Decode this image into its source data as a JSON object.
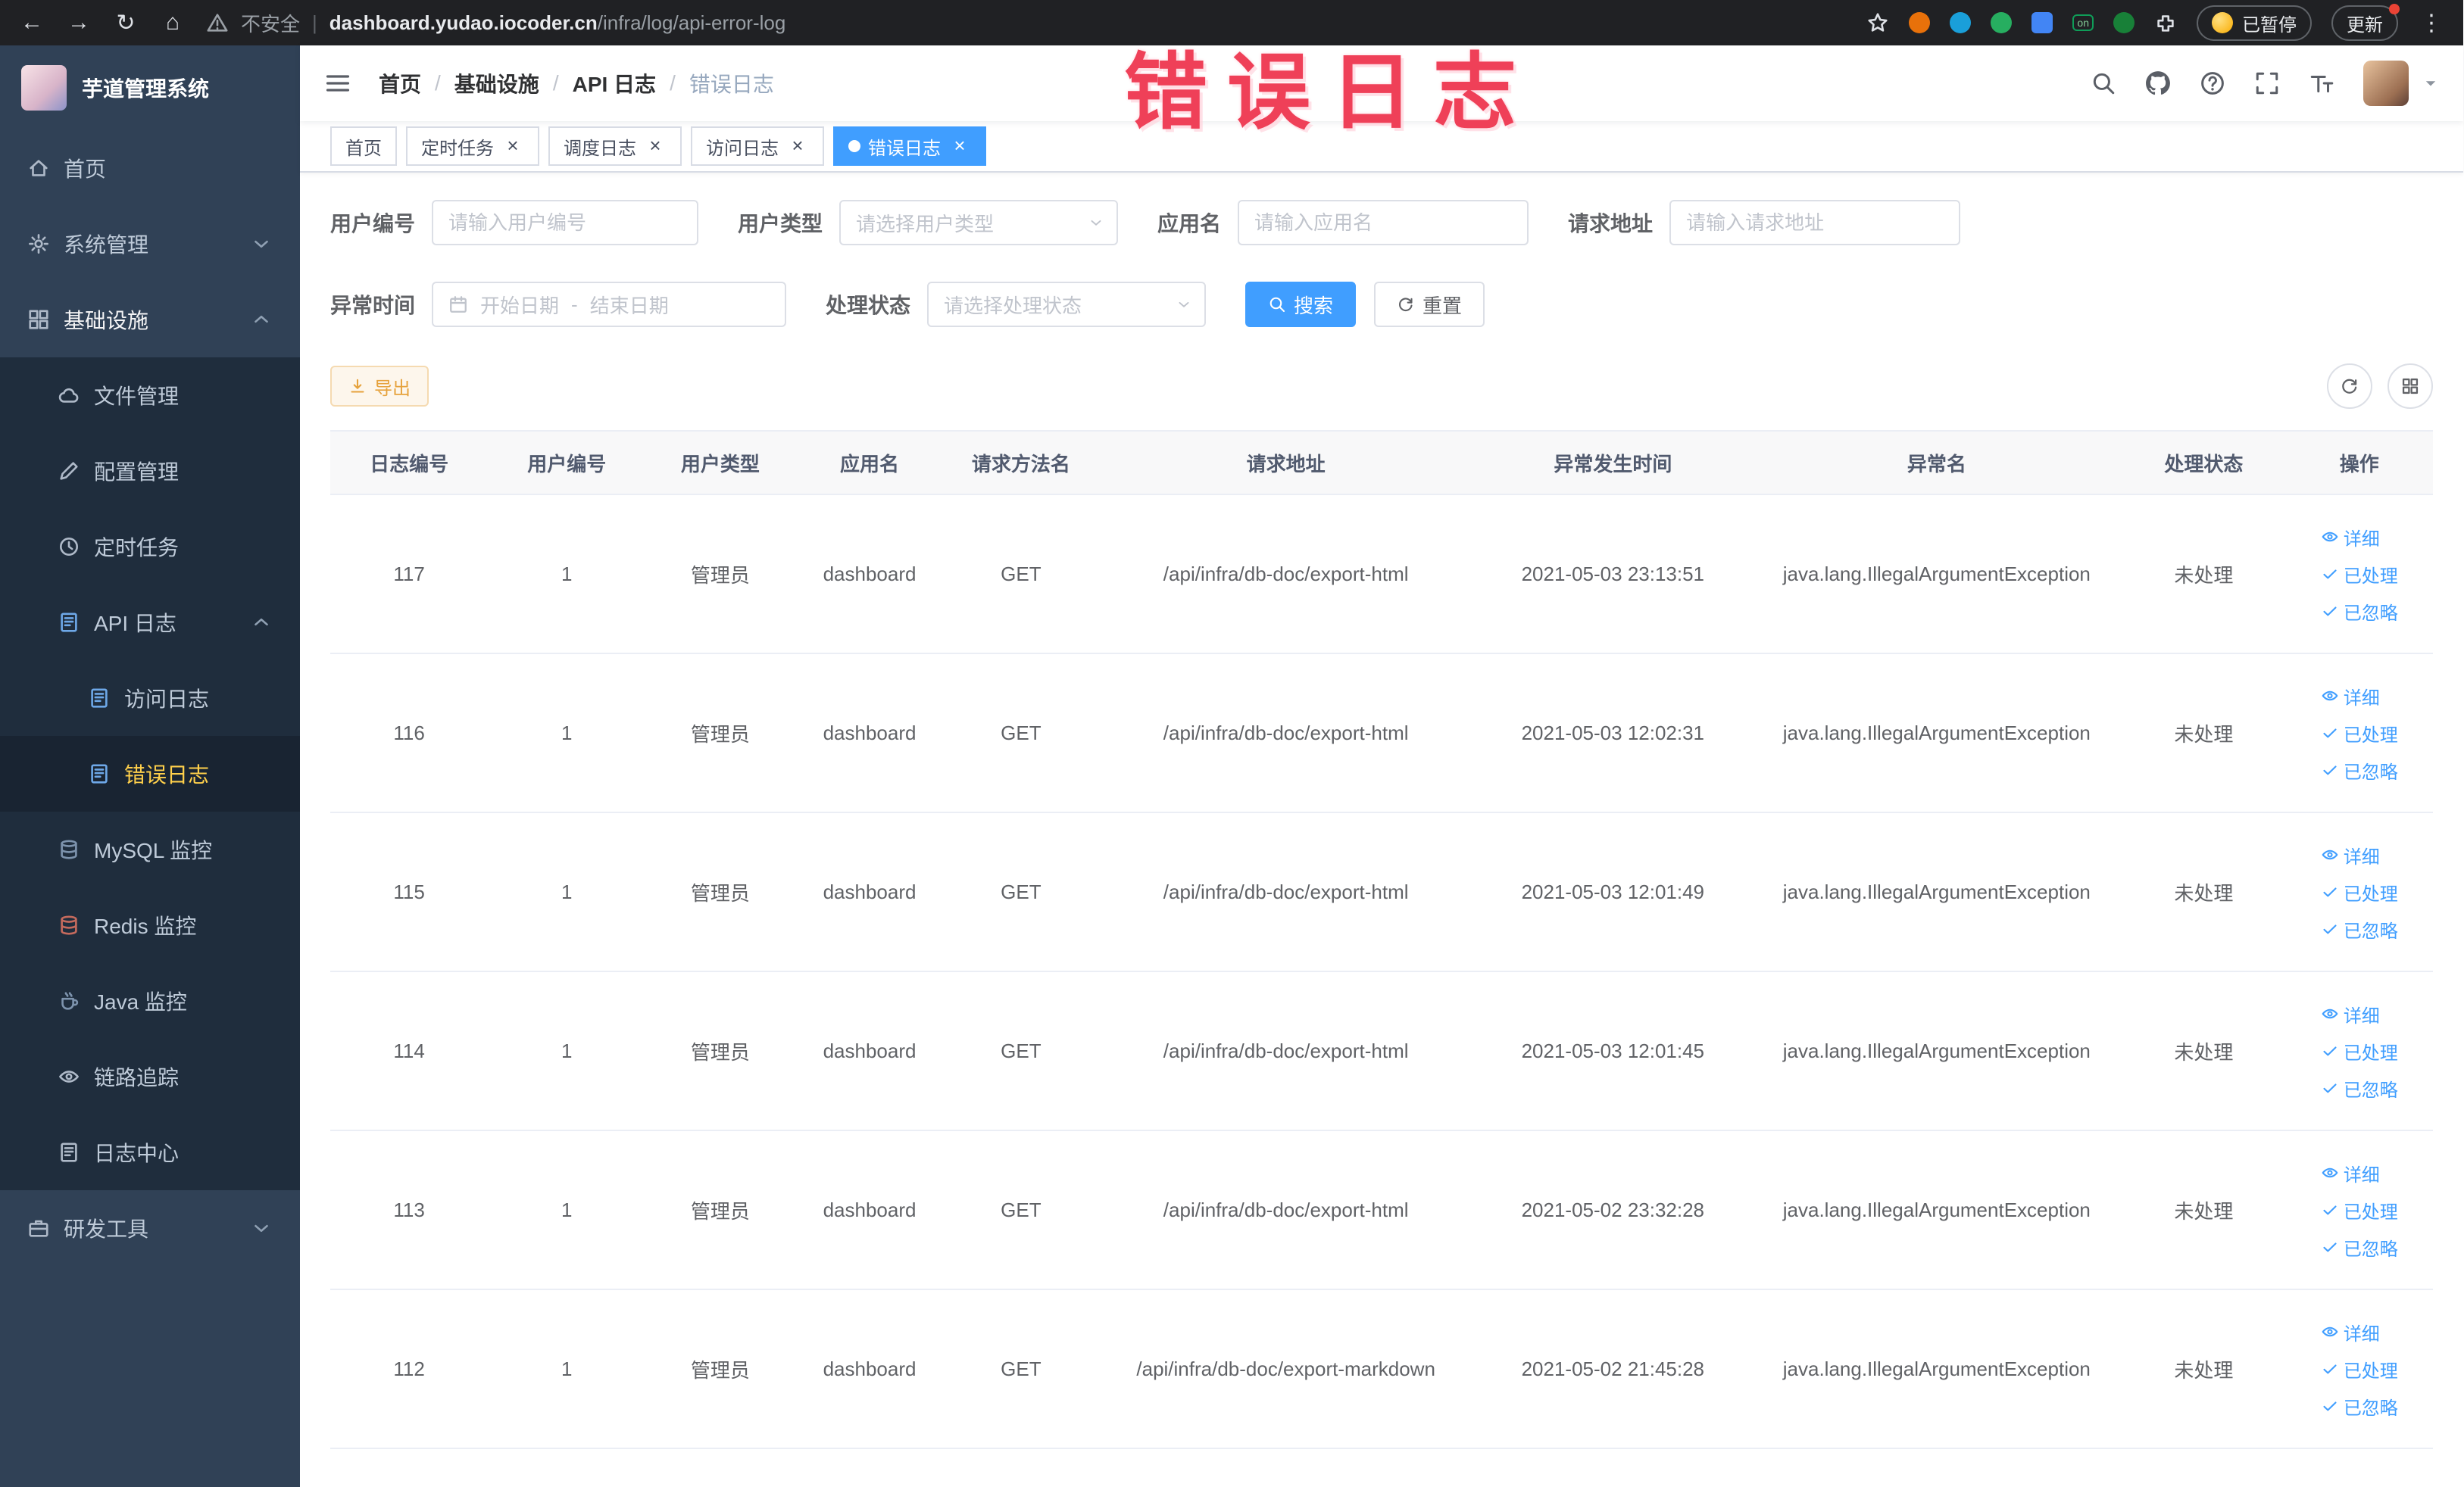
{
  "browser": {
    "warning_label": "不安全",
    "url_domain": "dashboard.yudao.iocoder.cn",
    "url_path": "/infra/log/api-error-log",
    "extension_badge": "on",
    "paused_button": "已暂停",
    "update_button": "更新"
  },
  "overlay_title": "错误日志",
  "sidebar": {
    "logo_title": "芋道管理系统",
    "items": {
      "home": "首页",
      "system": "系统管理",
      "infra": "基础设施",
      "file": "文件管理",
      "config": "配置管理",
      "job": "定时任务",
      "api_log": "API 日志",
      "access_log": "访问日志",
      "error_log": "错误日志",
      "mysql": "MySQL 监控",
      "redis": "Redis 监控",
      "java": "Java 监控",
      "trace": "链路追踪",
      "log_center": "日志中心",
      "dev_tools": "研发工具"
    }
  },
  "breadcrumb": {
    "separator": "/",
    "items": [
      "首页",
      "基础设施",
      "API 日志",
      "错误日志"
    ]
  },
  "tabs": [
    {
      "label": "首页"
    },
    {
      "label": "定时任务"
    },
    {
      "label": "调度日志"
    },
    {
      "label": "访问日志"
    },
    {
      "label": "错误日志"
    }
  ],
  "filters": {
    "user_id": {
      "label": "用户编号",
      "placeholder": "请输入用户编号"
    },
    "user_type": {
      "label": "用户类型",
      "placeholder": "请选择用户类型"
    },
    "app_name": {
      "label": "应用名",
      "placeholder": "请输入应用名"
    },
    "request_url": {
      "label": "请求地址",
      "placeholder": "请输入请求地址"
    },
    "exception_time": {
      "label": "异常时间",
      "start_placeholder": "开始日期",
      "separator": "-",
      "end_placeholder": "结束日期"
    },
    "process_status": {
      "label": "处理状态",
      "placeholder": "请选择处理状态"
    },
    "search_button": "搜索",
    "reset_button": "重置"
  },
  "toolbar": {
    "export_button": "导出"
  },
  "table": {
    "columns": [
      "日志编号",
      "用户编号",
      "用户类型",
      "应用名",
      "请求方法名",
      "请求地址",
      "异常发生时间",
      "异常名",
      "处理状态",
      "操作"
    ],
    "actions": {
      "detail": "详细",
      "processed": "已处理",
      "ignored": "已忽略"
    },
    "rows": [
      {
        "id": "117",
        "user_id": "1",
        "user_type": "管理员",
        "app": "dashboard",
        "method": "GET",
        "url": "/api/infra/db-doc/export-html",
        "time": "2021-05-03 23:13:51",
        "exception": "java.lang.IllegalArgumentException",
        "status": "未处理"
      },
      {
        "id": "116",
        "user_id": "1",
        "user_type": "管理员",
        "app": "dashboard",
        "method": "GET",
        "url": "/api/infra/db-doc/export-html",
        "time": "2021-05-03 12:02:31",
        "exception": "java.lang.IllegalArgumentException",
        "status": "未处理"
      },
      {
        "id": "115",
        "user_id": "1",
        "user_type": "管理员",
        "app": "dashboard",
        "method": "GET",
        "url": "/api/infra/db-doc/export-html",
        "time": "2021-05-03 12:01:49",
        "exception": "java.lang.IllegalArgumentException",
        "status": "未处理"
      },
      {
        "id": "114",
        "user_id": "1",
        "user_type": "管理员",
        "app": "dashboard",
        "method": "GET",
        "url": "/api/infra/db-doc/export-html",
        "time": "2021-05-03 12:01:45",
        "exception": "java.lang.IllegalArgumentException",
        "status": "未处理"
      },
      {
        "id": "113",
        "user_id": "1",
        "user_type": "管理员",
        "app": "dashboard",
        "method": "GET",
        "url": "/api/infra/db-doc/export-html",
        "time": "2021-05-02 23:32:28",
        "exception": "java.lang.IllegalArgumentException",
        "status": "未处理"
      },
      {
        "id": "112",
        "user_id": "1",
        "user_type": "管理员",
        "app": "dashboard",
        "method": "GET",
        "url": "/api/infra/db-doc/export-markdown",
        "time": "2021-05-02 21:45:28",
        "exception": "java.lang.IllegalArgumentException",
        "status": "未处理"
      }
    ]
  },
  "colors": {
    "accent_blue": "#409eff",
    "sidebar_bg": "#304156",
    "submenu_bg": "#1f2d3d",
    "active_menu_text": "#ffd04b",
    "warning_button": "#e6a23c",
    "annotation_red": "#ef4058"
  }
}
